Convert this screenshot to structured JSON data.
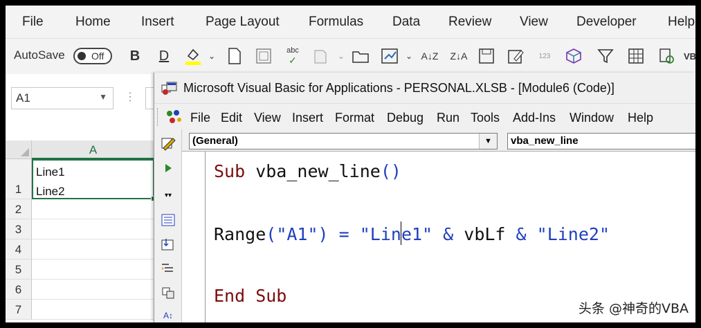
{
  "excel": {
    "ribbon_tabs": [
      "File",
      "Home",
      "Insert",
      "Page Layout",
      "Formulas",
      "Data",
      "Review",
      "View",
      "Developer",
      "Help"
    ],
    "autosave": {
      "label": "AutoSave",
      "state": "Off"
    },
    "name_box": "A1",
    "column_header": "A",
    "row_numbers": [
      "1",
      "2",
      "3",
      "4",
      "5",
      "6",
      "7"
    ],
    "cell_a1": {
      "line1": "Line1",
      "line2": "Line2"
    },
    "accent_color": "#217346"
  },
  "vba": {
    "title": "Microsoft Visual Basic for Applications - PERSONAL.XLSB - [Module6 (Code)]",
    "menu": [
      "File",
      "Edit",
      "View",
      "Insert",
      "Format",
      "Debug",
      "Run",
      "Tools",
      "Add-Ins",
      "Window",
      "Help"
    ],
    "object_dropdown": "(General)",
    "procedure_dropdown": "vba_new_line",
    "code": {
      "line1_kw": "Sub",
      "line1_name": " vba_new_line",
      "line1_parens": "()",
      "line2_range": "Range",
      "line2_arg": "(\"A1\")",
      "line2_eq": " = ",
      "line2_str1_a": "\"Lin",
      "line2_str1_b": "e1\"",
      "line2_amp1": " & ",
      "line2_vblf": "vbLf",
      "line2_amp2": " & ",
      "line2_str2": "\"Line2\"",
      "line3": "End Sub"
    },
    "keyword_color": "#7a0c0c",
    "string_color": "#1f3fbf"
  },
  "watermark": "头条 @神奇的VBA"
}
